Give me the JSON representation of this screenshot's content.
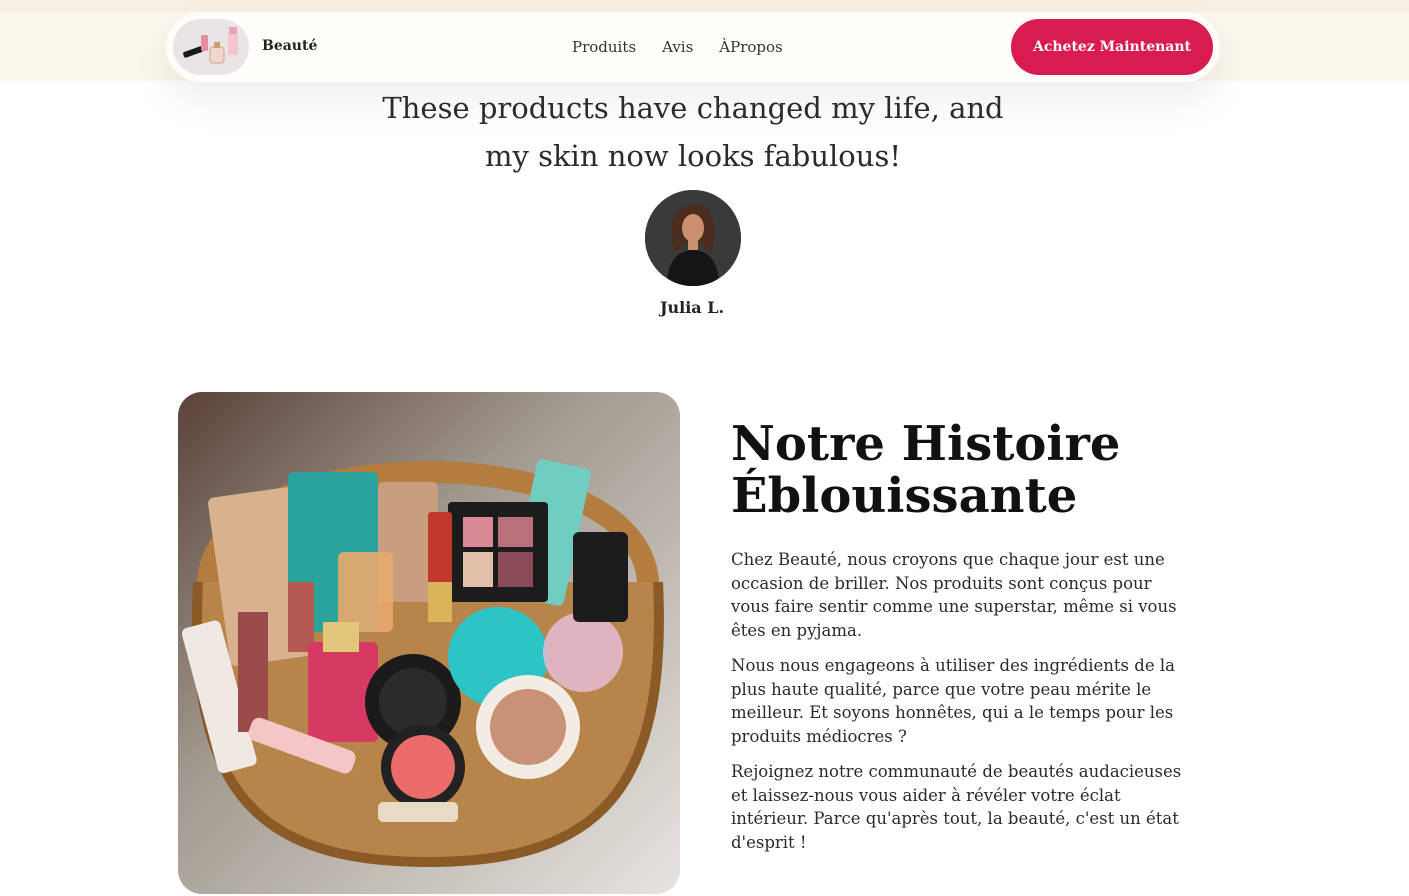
{
  "header": {
    "brand": "Beauté",
    "nav": [
      "Produits",
      "Avis",
      "ÀPropos"
    ],
    "cta_label": "Achetez Maintenant"
  },
  "testimonial": {
    "quote_line1": "These products have changed my life, and",
    "quote_line2": "my skin now looks fabulous!",
    "author": "Julia L."
  },
  "story": {
    "title_line1": "Notre Histoire",
    "title_line2": "Éblouissante",
    "paragraphs": [
      "Chez Beauté, nous croyons que chaque jour est une occasion de briller. Nos produits sont conçus pour vous faire sentir comme une superstar, même si vous êtes en pyjama.",
      "Nous nous engageons à utiliser des ingrédients de la plus haute qualité, parce que votre peau mérite le meilleur. Et soyons honnêtes, qui a le temps pour les produits médiocres ?",
      "Rejoignez notre communauté de beautés audacieuses et laissez-nous vous aider à révéler votre éclat intérieur. Parce qu'après tout, la beauté, c'est un état d'esprit !"
    ]
  },
  "colors": {
    "accent": "#d81b50",
    "header_bg": "#fbf6ec"
  }
}
